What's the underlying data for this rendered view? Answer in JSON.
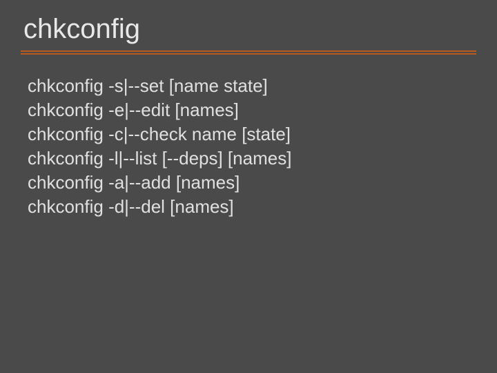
{
  "title": "chkconfig",
  "lines": [
    "chkconfig -s|--set [name state]",
    "chkconfig -e|--edit [names]",
    "chkconfig -c|--check name [state]",
    "chkconfig -l|--list [--deps] [names]",
    "chkconfig -a|--add [names]",
    "chkconfig -d|--del [names]"
  ]
}
